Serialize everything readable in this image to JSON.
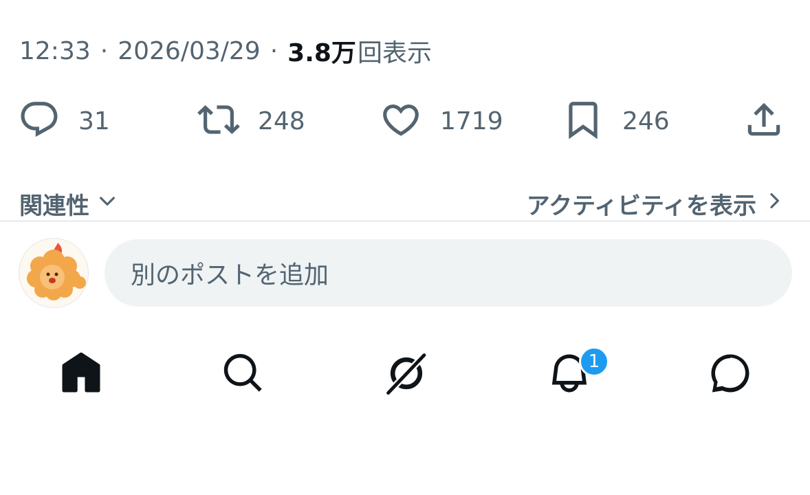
{
  "tweet_meta": {
    "time": "12:33",
    "separator": "·",
    "date": "2026/03/29",
    "views_count": "3.8万",
    "views_label": "回表示"
  },
  "actions": {
    "reply_count": "31",
    "retweet_count": "248",
    "like_count": "1719",
    "bookmark_count": "246"
  },
  "sort": {
    "label": "関連性",
    "activity_link": "アクティビティを表示"
  },
  "compose": {
    "placeholder": "別のポストを追加"
  },
  "tabbar": {
    "notification_badge": "1"
  },
  "icons": [
    "reply-icon",
    "retweet-icon",
    "like-icon",
    "bookmark-icon",
    "share-icon",
    "chevron-down-icon",
    "chevron-right-icon",
    "home-icon",
    "search-icon",
    "grok-icon",
    "bell-icon",
    "messages-icon"
  ],
  "colors": {
    "text_secondary": "#536471",
    "text_primary": "#0f1419",
    "accent": "#1d9bf0",
    "input_bg": "#eff3f4",
    "divider": "#cfd9de"
  }
}
